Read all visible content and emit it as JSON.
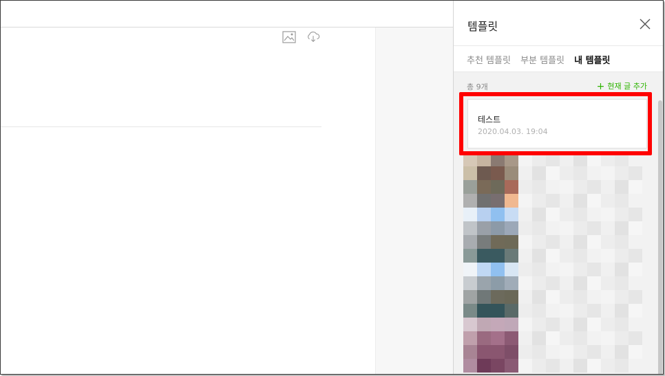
{
  "panel": {
    "title": "템플릿",
    "close_icon": "close-icon",
    "tabs": [
      {
        "label": "추천 템플릿",
        "active": false
      },
      {
        "label": "부분 템플릿",
        "active": false
      },
      {
        "label": "내 템플릿",
        "active": true
      }
    ],
    "count_label": "총 9개",
    "add_label": "현재 글 추가",
    "accent_color": "#2db400"
  },
  "templates": [
    {
      "title": "테스트",
      "date": "2020.04.03. 19:04",
      "highlighted": true
    }
  ],
  "editor": {
    "toolbar_icons": [
      "image-icon",
      "cloud-download-icon"
    ]
  },
  "colors": {
    "highlight": "#ff0000",
    "panel_bg": "#f2f2f2"
  }
}
